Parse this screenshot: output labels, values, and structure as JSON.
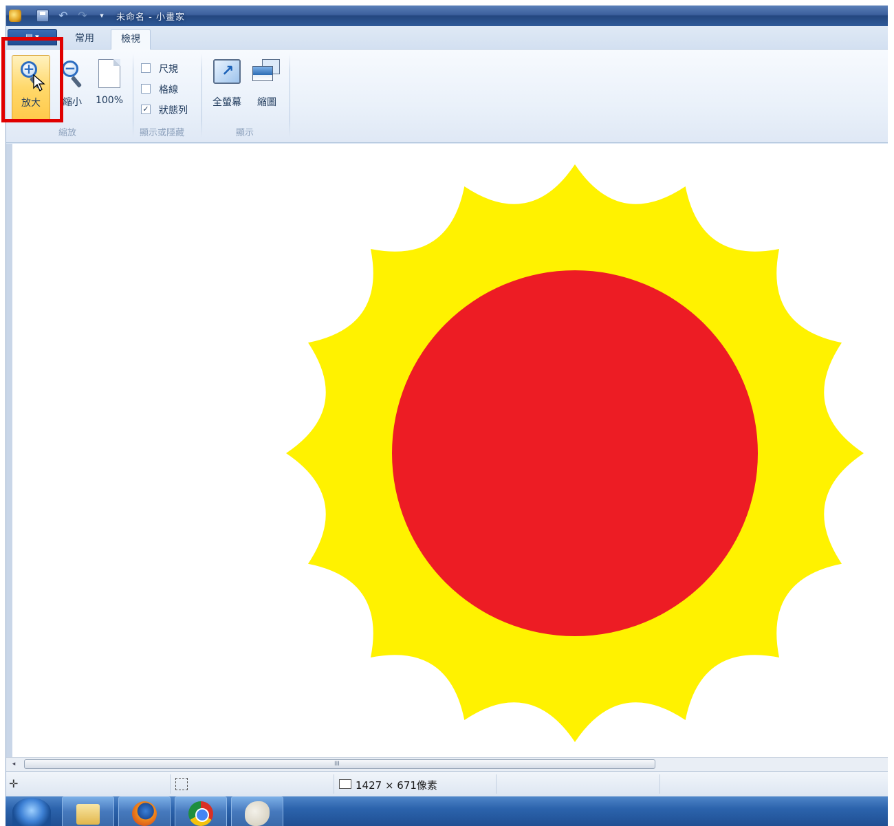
{
  "titlebar": {
    "title": "未命名 - 小畫家",
    "qa_dropdown_glyph": "▾"
  },
  "tabs": {
    "file_menu": "▤ ▾",
    "home": "常用",
    "view": "檢視"
  },
  "ribbon": {
    "zoom_group": {
      "label": "縮放",
      "zoom_in": "放大",
      "zoom_out": "縮小",
      "zoom_100": "100%"
    },
    "show_hide_group": {
      "label": "顯示或隱藏",
      "rulers": "尺規",
      "gridlines": "格線",
      "status_bar": "狀態列",
      "rulers_checked": false,
      "gridlines_checked": false,
      "status_bar_checked": true,
      "check_mark": "✓"
    },
    "display_group": {
      "label": "顯示",
      "fullscreen": "全螢幕",
      "thumbnail": "縮圖"
    }
  },
  "canvas": {
    "image": "sun-drawing",
    "colors": {
      "rays": "#fff200",
      "disc": "#ed1c24",
      "background": "#ffffff"
    }
  },
  "scrollbar": {
    "left_arrow": "◂",
    "grip": "III"
  },
  "statusbar": {
    "crosshair_glyph": "✛",
    "canvas_size": "1427 × 671像素"
  },
  "taskbar": {
    "items": [
      "start",
      "windows-explorer",
      "firefox",
      "chrome",
      "paint"
    ]
  },
  "accent": {
    "highlight": "#e00000",
    "ribbon_hover": "#ffd86a"
  }
}
